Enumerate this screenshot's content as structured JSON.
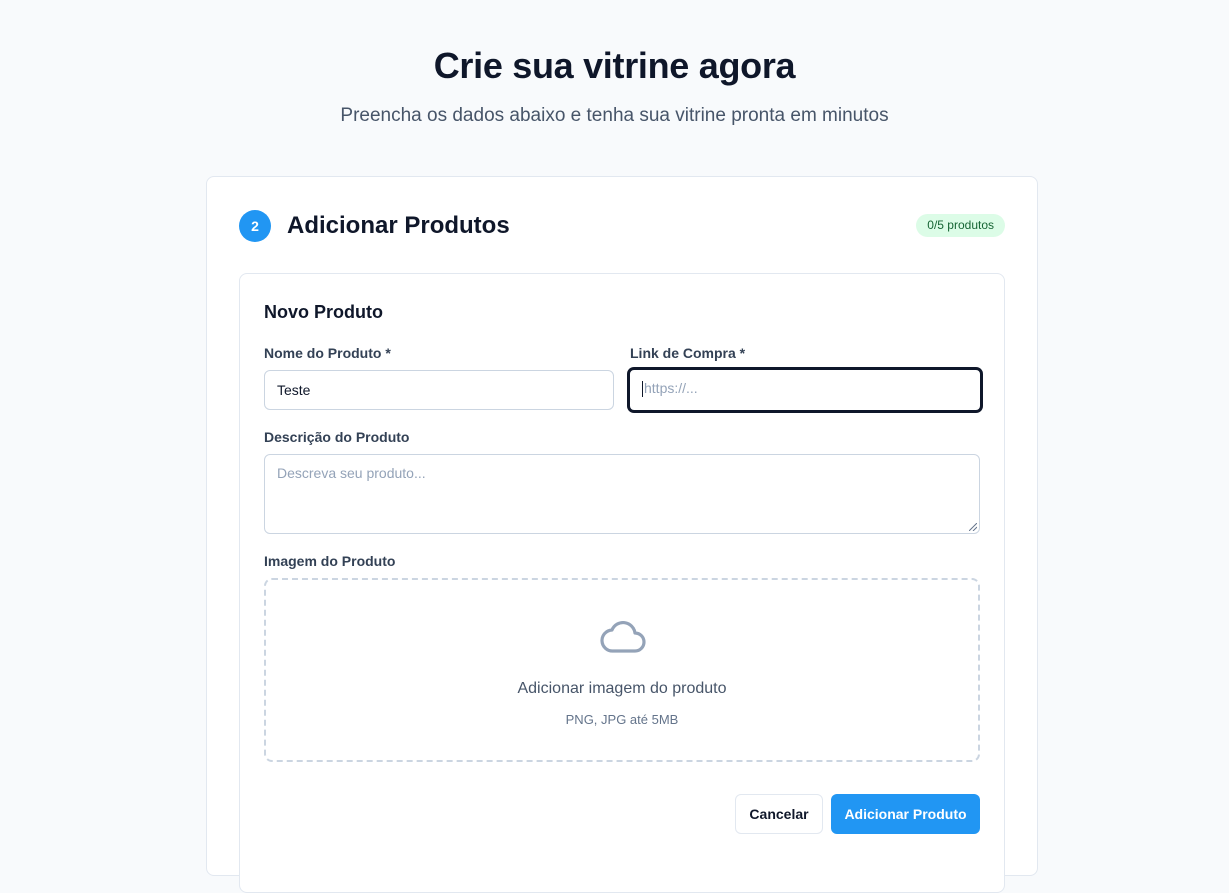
{
  "hero": {
    "title": "Crie sua vitrine agora",
    "subtitle": "Preencha os dados abaixo e tenha sua vitrine pronta em minutos"
  },
  "step": {
    "number": "2",
    "title": "Adicionar Produtos",
    "badge": "0/5 produtos",
    "badge_color": "#dcfce7",
    "accent_color": "#2196f3"
  },
  "form": {
    "title": "Novo Produto",
    "name_label": "Nome do Produto *",
    "name_value": "Teste",
    "link_label": "Link de Compra *",
    "link_placeholder": "https://...",
    "description_label": "Descrição do Produto",
    "description_placeholder": "Descreva seu produto...",
    "image_label": "Imagem do Produto",
    "upload_icon": "cloud-icon",
    "upload_text": "Adicionar imagem do produto",
    "upload_hint": "PNG, JPG até 5MB",
    "cancel_label": "Cancelar",
    "submit_label": "Adicionar Produto"
  }
}
